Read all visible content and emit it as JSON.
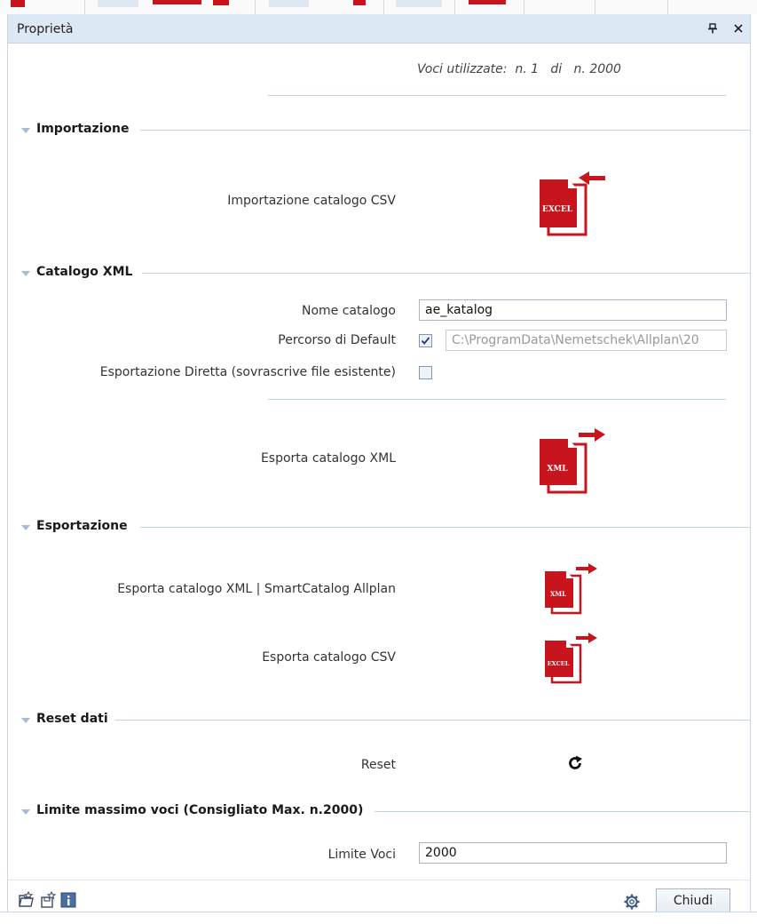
{
  "window": {
    "title": "Proprietà",
    "pin_glyph": "pin-icon",
    "close_glyph": "close-icon"
  },
  "usage": {
    "text": "Voci utilizzate:  n. 1   di   n. 2000"
  },
  "sections": {
    "import": {
      "title": "Importazione",
      "csv_label": "Importazione catalogo CSV",
      "icon": "import-excel-icon",
      "icon_text": "EXCEL"
    },
    "xml": {
      "title": "Catalogo XML",
      "name_label": "Nome catalogo",
      "name_value": "ae_katalog",
      "path_label": "Percorso di Default",
      "path_checked": true,
      "path_value": "C:\\ProgramData\\Nemetschek\\Allplan\\20",
      "direct_label": "Esportazione Diretta (sovrascrive file esistente)",
      "direct_checked": false,
      "export_label": "Esporta catalogo XML",
      "export_icon_text": "XML"
    },
    "export": {
      "title": "Esportazione",
      "smart_label": "Esporta catalogo XML | SmartCatalog Allplan",
      "smart_icon_text": "XML",
      "csv_label": "Esporta catalogo CSV",
      "csv_icon_text": "EXCEL"
    },
    "reset": {
      "title": "Reset dati",
      "label": "Reset",
      "icon": "reset-icon"
    },
    "limit": {
      "title": "Limite massimo voci (Consigliato Max. n.2000)",
      "label": "Limite Voci",
      "value": "2000"
    }
  },
  "footer": {
    "close_label": "Chiudi",
    "icons": [
      "open-favorite-icon",
      "save-favorite-icon",
      "info-icon",
      "settings-icon"
    ]
  },
  "colors": {
    "titlebar": "#dde8f5",
    "section_line": "#c3d2e4",
    "icon_red": "#c8141c"
  }
}
